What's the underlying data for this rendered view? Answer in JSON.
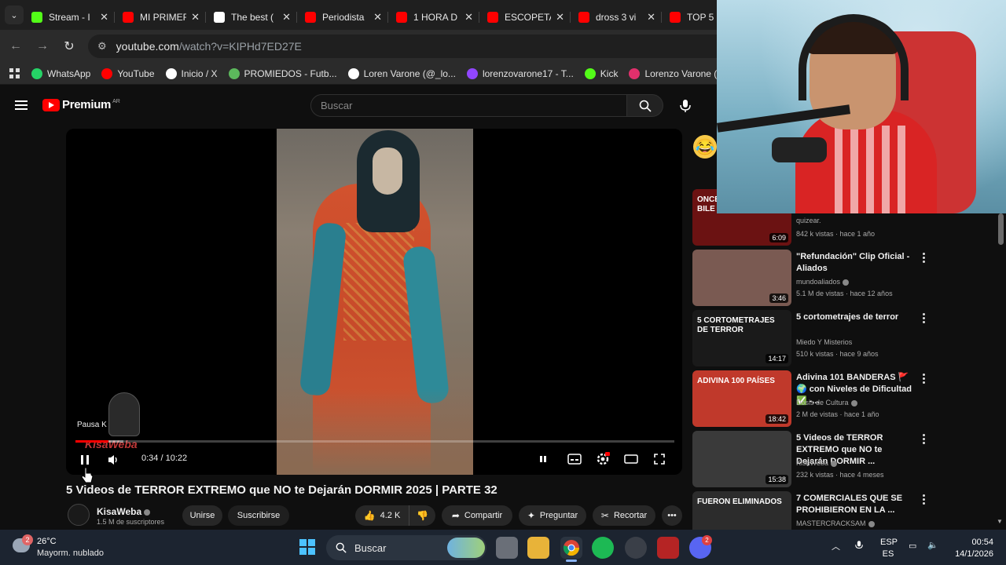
{
  "browser": {
    "tabs": [
      {
        "title": "Stream - I",
        "color": "#53fc18"
      },
      {
        "title": "MI PRIMER",
        "color": "#ff0000"
      },
      {
        "title": "The best (",
        "color": "#ffffff"
      },
      {
        "title": "Periodista",
        "color": "#ff0000"
      },
      {
        "title": "1 HORA D",
        "color": "#ff0000"
      },
      {
        "title": "ESCOPETA",
        "color": "#ff0000"
      },
      {
        "title": "dross 3 vi",
        "color": "#ff0000"
      },
      {
        "title": "TOP 5 M",
        "color": "#ff0000"
      }
    ],
    "tab_close": "✕",
    "url_host": "youtube.com",
    "url_path": "/watch?v=KIPHd7ED27E",
    "bookmarks": [
      {
        "label": "WhatsApp",
        "color": "#25d366"
      },
      {
        "label": "YouTube",
        "color": "#ff0000"
      },
      {
        "label": "Inicio / X",
        "color": "#ffffff"
      },
      {
        "label": "PROMIEDOS - Futb...",
        "color": "#5cb85c"
      },
      {
        "label": "Loren Varone (@_lo...",
        "color": "#ffffff"
      },
      {
        "label": "lorenzovarone17 - T...",
        "color": "#9146ff"
      },
      {
        "label": "Kick",
        "color": "#53fc18"
      },
      {
        "label": "Lorenzo Varone (Inst",
        "color": "#e1306c"
      }
    ]
  },
  "youtube": {
    "logo_text": "Premium",
    "region": "AR",
    "search_placeholder": "Buscar"
  },
  "player": {
    "pause_tooltip": "Pausa",
    "pause_key": "K",
    "watermark": "KisaWeba",
    "current_time": "0:34",
    "duration": "10:22",
    "time_separator": " / ",
    "progress_fraction": 0.055,
    "loaded_fraction": 0.08
  },
  "video": {
    "title": "5 Videos de TERROR EXTREMO que NO te Dejarán DORMIR 2025 | PARTE 32",
    "channel": "KisaWeba",
    "subscribers": "1.5 M de suscriptores",
    "join_label": "Unirse",
    "subscribe_label": "Suscribirse",
    "likes": "4.2 K",
    "share_label": "Compartir",
    "ask_label": "Preguntar",
    "clip_label": "Recortar"
  },
  "recommendations": [
    {
      "title": "",
      "channel": "quizear.",
      "meta": "842 k vistas · hace 1 año",
      "duration": "6:09",
      "verified": false,
      "thumb": "#6b1212",
      "thumb_text": "ONCE\nBILE"
    },
    {
      "title": "\"Refundación\" Clip Oficial - Aliados",
      "channel": "mundoaliados",
      "meta": "5.1 M de vistas · hace 12 años",
      "duration": "3:46",
      "verified": true,
      "thumb": "#7a5a52",
      "thumb_text": ""
    },
    {
      "title": "5 cortometrajes de terror",
      "channel": "Miedo Y Misterios",
      "meta": "510 k vistas · hace 9 años",
      "duration": "14:17",
      "verified": false,
      "thumb": "#1a1a1a",
      "thumb_text": "5 CORTOMETRAJES DE TERROR"
    },
    {
      "title": "Adivina 101 BANDERAS 🚩🌍 con Niveles de Dificultad ✅ -...",
      "channel": "Dosis de Cultura",
      "meta": "2 M de vistas · hace 1 año",
      "duration": "18:42",
      "verified": true,
      "thumb": "#c0392b",
      "thumb_text": "ADIVINA 100 PAÍSES"
    },
    {
      "title": "5 Videos de TERROR EXTREMO que NO te Dejarán DORMIR ...",
      "channel": "KisaWeba",
      "meta": "232 k vistas · hace 4 meses",
      "duration": "15:38",
      "verified": true,
      "thumb": "#3a3a3a",
      "thumb_text": ""
    },
    {
      "title": "7 COMERCIALES QUE SE PROHIBIERON EN LA ...",
      "channel": "MASTERCRACKSAM",
      "meta": "",
      "duration": "",
      "verified": true,
      "thumb": "#2c2c2c",
      "thumb_text": "FUERON ELIMINADOS"
    }
  ],
  "taskbar": {
    "weather_temp": "26°C",
    "weather_desc": "Mayorm. nublado",
    "weather_badge": "2",
    "search_label": "Buscar",
    "discord_badge": "2",
    "lang_top": "ESP",
    "lang_bottom": "ES",
    "time": "00:54",
    "date": "14/1/2026"
  }
}
